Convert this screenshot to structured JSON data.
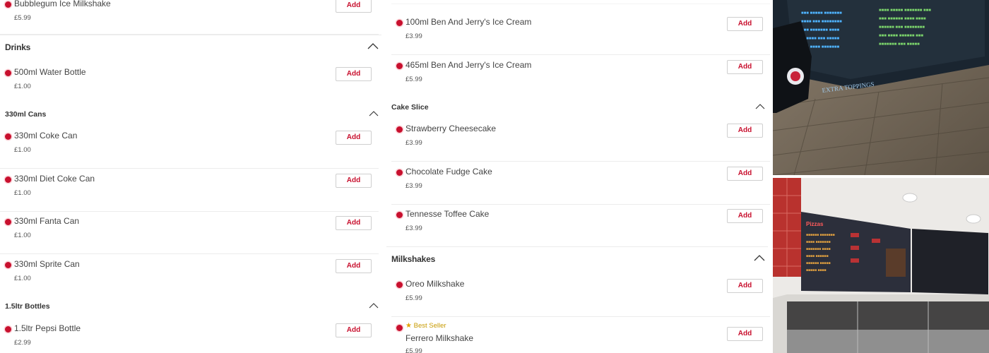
{
  "left": {
    "top_item": {
      "name": "Bubblegum Ice Milkshake",
      "price": "£5.99"
    },
    "section": {
      "title": "Drinks"
    },
    "water": {
      "name": "500ml Water Bottle",
      "price": "£1.00"
    },
    "cans": {
      "title": "330ml Cans",
      "items": [
        {
          "name": "330ml Coke Can",
          "price": "£1.00"
        },
        {
          "name": "330ml Diet Coke Can",
          "price": "£1.00"
        },
        {
          "name": "330ml Fanta Can",
          "price": "£1.00"
        },
        {
          "name": "330ml Sprite Can",
          "price": "£1.00"
        }
      ]
    },
    "bottles": {
      "title": "1.5ltr Bottles",
      "items": [
        {
          "name": "1.5ltr Pepsi Bottle",
          "price": "£2.99"
        }
      ]
    }
  },
  "right": {
    "ice_cream": [
      {
        "name": "100ml Ben And Jerry's Ice Cream",
        "price": "£3.99"
      },
      {
        "name": "465ml Ben And Jerry's Ice Cream",
        "price": "£5.99"
      }
    ],
    "cake": {
      "title": "Cake Slice",
      "items": [
        {
          "name": "Strawberry Cheesecake",
          "price": "£3.99"
        },
        {
          "name": "Chocolate Fudge Cake",
          "price": "£3.99"
        },
        {
          "name": "Tennesse Toffee Cake",
          "price": "£3.99"
        }
      ]
    },
    "milkshakes": {
      "title": "Milkshakes",
      "items": [
        {
          "name": "Oreo Milkshake",
          "price": "£5.99"
        },
        {
          "name": "Ferrero Milkshake",
          "price": "£5.99",
          "badge": "Best Seller"
        }
      ]
    }
  },
  "add_label": "Add",
  "colors": {
    "accent": "#c8102e",
    "best_seller": "#c79a00"
  },
  "photo_menu_text": {
    "extra_toppings": "EXTRA TOPPINGS",
    "screen_heading": "Pizzas"
  }
}
